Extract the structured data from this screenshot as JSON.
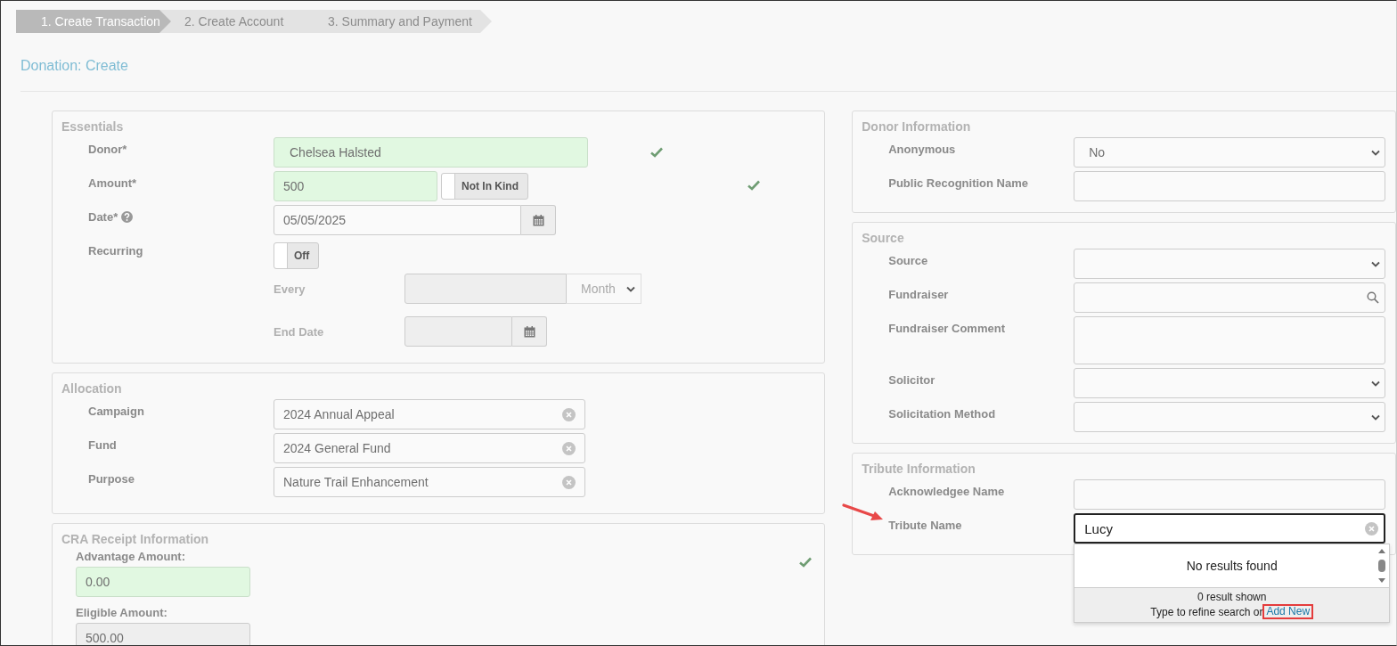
{
  "steps": [
    {
      "label": "1. Create Transaction",
      "selected": true
    },
    {
      "label": "2. Create Account",
      "selected": false
    },
    {
      "label": "3. Summary and Payment",
      "selected": false
    }
  ],
  "page_title": "Donation: Create",
  "left_sections": [
    {
      "title": "Essentials",
      "rows": [
        {
          "kind": "input",
          "label": "Donor*",
          "value": "Chelsea Halsted",
          "valid": true
        },
        {
          "kind": "amount",
          "label": "Amount*",
          "value": "500",
          "valid": true,
          "toggle": {
            "label": "Not In Kind",
            "on": false
          }
        },
        {
          "kind": "date",
          "label": "Date*",
          "value": "05/05/2025",
          "help": true
        },
        {
          "kind": "toggle",
          "label": "Recurring",
          "toggle": {
            "label": "Off",
            "on": false
          }
        },
        {
          "kind": "sub_period",
          "label": "Every",
          "disabled": true,
          "unit": "Month"
        },
        {
          "kind": "sub_date",
          "label": "End Date",
          "disabled": true
        }
      ]
    },
    {
      "title": "Allocation",
      "rows": [
        {
          "kind": "clearable",
          "label": "Campaign",
          "value": "2024 Annual Appeal"
        },
        {
          "kind": "clearable",
          "label": "Fund",
          "value": "2024 General Fund"
        },
        {
          "kind": "clearable",
          "label": "Purpose",
          "value": "Nature Trail Enhancement"
        }
      ]
    },
    {
      "title": "CRA Receipt Information",
      "rows": [
        {
          "kind": "stacked",
          "label": "Advantage Amount:",
          "value": "0.00",
          "valid": true,
          "disabled": false
        },
        {
          "kind": "stacked",
          "label": "Eligible Amount:",
          "value": "500.00",
          "valid": false,
          "disabled": true
        }
      ]
    }
  ],
  "right_sections": [
    {
      "title": "Donor Information",
      "rows": [
        {
          "kind": "select",
          "label": "Anonymous",
          "value": "No"
        },
        {
          "kind": "input",
          "label": "Public Recognition Name"
        }
      ]
    },
    {
      "title": "Source",
      "rows": [
        {
          "kind": "select",
          "label": "Source"
        },
        {
          "kind": "search",
          "label": "Fundraiser"
        },
        {
          "kind": "textarea",
          "label": "Fundraiser Comment"
        },
        {
          "kind": "select",
          "label": "Solicitor"
        },
        {
          "kind": "select",
          "label": "Solicitation Method"
        }
      ]
    },
    {
      "title": "Tribute Information",
      "rows": [
        {
          "kind": "input",
          "label": "Acknowledgee Name"
        },
        {
          "kind": "autocomplete",
          "label": "Tribute Name",
          "value": "Lucy",
          "focused": true,
          "annotated": true,
          "dropdown": {
            "message": "No results found",
            "count": "0 result shown",
            "hint": "Type to refine search or",
            "link": "Add New",
            "link_highlighted": true
          }
        }
      ]
    }
  ]
}
